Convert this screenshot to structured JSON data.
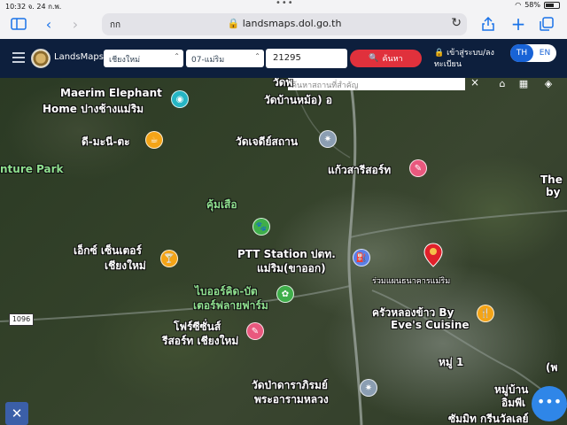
{
  "status": {
    "time": "10:32",
    "date": "จ. 24 ก.พ.",
    "battery": "58%"
  },
  "safari": {
    "tab_text": "กก",
    "url": "landsmaps.dol.go.th"
  },
  "header": {
    "brand": "LandsMaps",
    "province": "เชียงใหม่",
    "district": "07-แม่ริม",
    "parcel_value": "21295",
    "search_label": "ค้นหา",
    "login_label": "เข้าสู่ระบบ/ลงทะเบียน",
    "lang_th": "TH",
    "lang_en": "EN"
  },
  "map": {
    "place_search_placeholder": "ค้นหาสถานที่สำคัญ",
    "close": "×",
    "road_badge": "1096",
    "labels": {
      "elephant_1": "Maerim Elephant",
      "elephant_2": "Home ปางช้างแม่ริม",
      "temple_top": "วัดบ้านหม้อ) อ",
      "temple_top2": "วัดพ",
      "dee_mani": "ดี-มะนี-ตะ",
      "wat_chedi": "วัดเจดีย์สถาน",
      "adventure": "nture Park",
      "kaew_resort": "แก้วสารีสอร์ท",
      "the_by_1": "The",
      "the_by_2": "by",
      "khum_suea": "คุ้มเสือ",
      "exi_center_1": "เอ็กซ์ เซ็นเตอร์",
      "exi_center_2": "เชียงใหม่",
      "ptt_1": "PTT Station ปตท.",
      "ptt_2": "แม่ริม(ขาออก)",
      "small_near_marker": "ร่วมแผนธนาคารแม่ริม",
      "bio_1": "ไบออร์คิด-บัต",
      "bio_2": "เตอร์ฟลายฟาร์ม",
      "eve_1": "ครัวหลองข้าว By",
      "eve_2": "Eve's Cuisine",
      "forest_1": "โฟร์ซีซั่นส์",
      "forest_2": "รีสอร์ท เชียงใหม่",
      "moo1": "หมู่ 1",
      "wat_pa_1": "วัดป่าดาราภิรมย์",
      "wat_pa_2": "พระอารามหลวง",
      "moo_ban_1": "หมู่บ้าน",
      "moo_ban_2": "อิมพีเ",
      "summit": "ซัมมิท กรีนวัลเลย์",
      "right_edge": "(พ"
    }
  },
  "colors": {
    "header_bg": "#0d1f3d",
    "search_red": "#e0313c",
    "accent_blue": "#1863d6"
  }
}
